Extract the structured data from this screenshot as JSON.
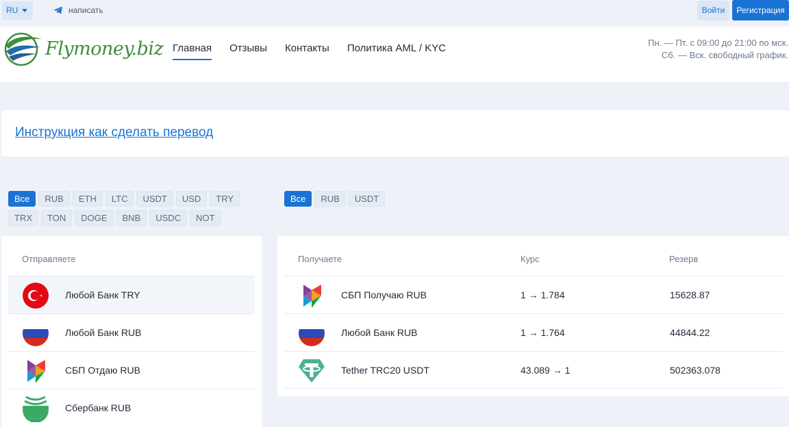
{
  "topbar": {
    "lang": "RU",
    "write_label": "написать",
    "login_label": "Войти",
    "register_label": "Регистрация"
  },
  "header": {
    "logo_text": "Flymoney.biz",
    "nav": [
      "Главная",
      "Отзывы",
      "Контакты",
      "Политика AML / KYC"
    ],
    "hours_line1": "Пн. — Пт. с 09:00 до 21:00 по мск.",
    "hours_line2": "Сб. — Вск. свободный график."
  },
  "instruction_link": "Инструкция как сделать перевод",
  "send_filters": [
    "Все",
    "RUB",
    "ETH",
    "LTC",
    "USDT",
    "USD",
    "TRY",
    "TRX",
    "TON",
    "DOGE",
    "BNB",
    "USDC",
    "NOT"
  ],
  "receive_filters": [
    "Все",
    "RUB",
    "USDT"
  ],
  "send": {
    "header": "Отправляете",
    "items": [
      {
        "name": "Любой Банк TRY",
        "icon": "turkey-flag-icon"
      },
      {
        "name": "Любой Банк RUB",
        "icon": "russia-flag-icon"
      },
      {
        "name": "СБП Отдаю RUB",
        "icon": "sbp-icon"
      },
      {
        "name": "Сбербанк RUB",
        "icon": "sberbank-icon"
      }
    ]
  },
  "receive": {
    "header_receive": "Получаете",
    "header_rate": "Курс",
    "header_reserve": "Резерв",
    "items": [
      {
        "name": "СБП Получаю RUB",
        "rate": "1 → 1.784",
        "reserve": "15628.87",
        "icon": "sbp-icon"
      },
      {
        "name": "Любой Банк RUB",
        "rate": "1 → 1.764",
        "reserve": "44844.22",
        "icon": "russia-flag-icon"
      },
      {
        "name": "Tether TRC20 USDT",
        "rate": "43.089 → 1",
        "reserve": "502363.078",
        "icon": "tether-icon"
      }
    ]
  },
  "colors": {
    "accent": "#1a73d4",
    "background": "#eef2f8",
    "logo_green": "#3f8e3a"
  }
}
